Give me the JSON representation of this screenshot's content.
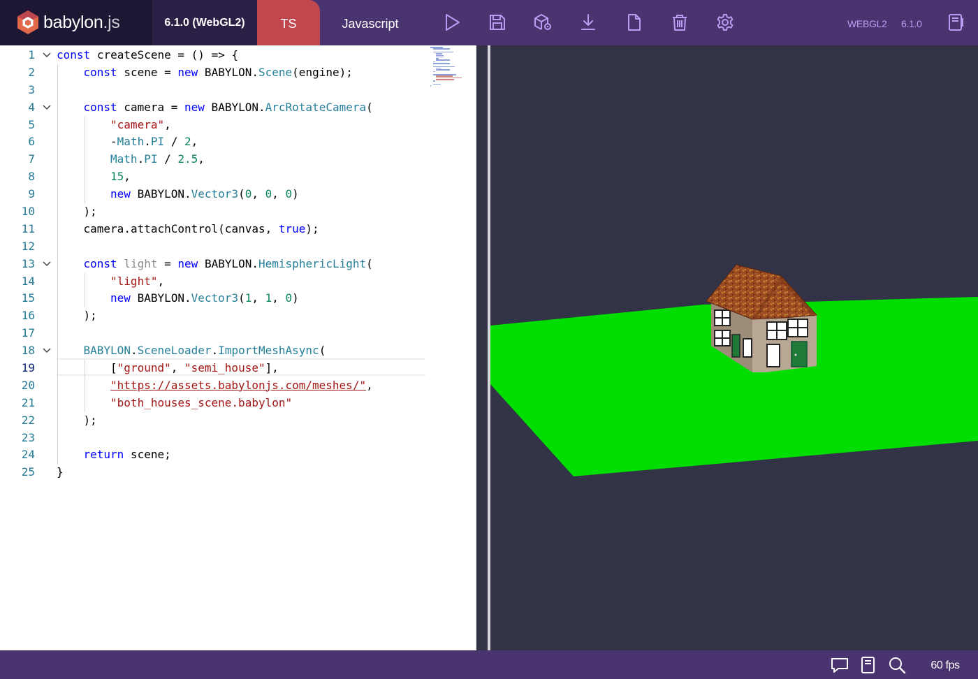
{
  "header": {
    "brand_name": "babylon",
    "brand_ext": ".js",
    "version_label": "6.1.0 (WebGL2)",
    "lang_ts": "TS",
    "lang_js": "Javascript",
    "engine_label": "WEBGL2",
    "version": "6.1.0",
    "toolbar_icons": [
      "play-icon",
      "save-icon",
      "cube-settings-icon",
      "download-icon",
      "new-file-icon",
      "trash-icon",
      "gear-icon",
      "examples-icon"
    ]
  },
  "editor": {
    "active_line": 19,
    "lines": [
      {
        "n": "1",
        "fold": true,
        "indent": 0,
        "tokens": [
          [
            "kw",
            "const"
          ],
          [
            "",
            "createScene = () => {"
          ]
        ]
      },
      {
        "n": "2",
        "fold": false,
        "indent": 1,
        "tokens": [
          [
            "kw",
            "const"
          ],
          [
            "",
            " scene = "
          ],
          [
            "kw",
            "new"
          ],
          [
            "",
            " BABYLON."
          ],
          [
            "cls",
            "Scene"
          ],
          [
            "",
            "(engine);"
          ]
        ]
      },
      {
        "n": "3",
        "fold": false,
        "indent": 0,
        "tokens": []
      },
      {
        "n": "4",
        "fold": true,
        "indent": 1,
        "tokens": [
          [
            "kw",
            "const"
          ],
          [
            "",
            " camera = "
          ],
          [
            "kw",
            "new"
          ],
          [
            "",
            " BABYLON."
          ],
          [
            "cls",
            "ArcRotateCamera"
          ],
          [
            "",
            "("
          ]
        ]
      },
      {
        "n": "5",
        "fold": false,
        "indent": 2,
        "tokens": [
          [
            "str",
            "\"camera\""
          ],
          [
            "",
            ","
          ]
        ]
      },
      {
        "n": "6",
        "fold": false,
        "indent": 2,
        "tokens": [
          [
            "",
            "-"
          ],
          [
            "cls",
            "Math"
          ],
          [
            "",
            "."
          ],
          [
            "cls",
            "PI"
          ],
          [
            "",
            " / "
          ],
          [
            "num",
            "2"
          ],
          [
            "",
            ","
          ]
        ]
      },
      {
        "n": "7",
        "fold": false,
        "indent": 2,
        "tokens": [
          [
            "cls",
            "Math"
          ],
          [
            "",
            "."
          ],
          [
            "cls",
            "PI"
          ],
          [
            "",
            " / "
          ],
          [
            "num",
            "2.5"
          ],
          [
            "",
            ","
          ]
        ]
      },
      {
        "n": "8",
        "fold": false,
        "indent": 2,
        "tokens": [
          [
            "num",
            "15"
          ],
          [
            "",
            ","
          ]
        ]
      },
      {
        "n": "9",
        "fold": false,
        "indent": 2,
        "tokens": [
          [
            "kw",
            "new"
          ],
          [
            "",
            " BABYLON."
          ],
          [
            "cls",
            "Vector3"
          ],
          [
            "",
            "("
          ],
          [
            "num",
            "0"
          ],
          [
            "",
            ", "
          ],
          [
            "num",
            "0"
          ],
          [
            "",
            ", "
          ],
          [
            "num",
            "0"
          ],
          [
            "",
            ")"
          ]
        ]
      },
      {
        "n": "10",
        "fold": false,
        "indent": 1,
        "tokens": [
          [
            "",
            ");"
          ]
        ]
      },
      {
        "n": "11",
        "fold": false,
        "indent": 1,
        "tokens": [
          [
            "",
            "camera.attachControl(canvas, "
          ],
          [
            "kw",
            "true"
          ],
          [
            "",
            ");"
          ]
        ]
      },
      {
        "n": "12",
        "fold": false,
        "indent": 0,
        "tokens": []
      },
      {
        "n": "13",
        "fold": true,
        "indent": 1,
        "tokens": [
          [
            "kw",
            "const"
          ],
          [
            "",
            " "
          ],
          [
            "unused",
            "light"
          ],
          [
            "",
            " = "
          ],
          [
            "kw",
            "new"
          ],
          [
            "",
            " BABYLON."
          ],
          [
            "cls",
            "HemisphericLight"
          ],
          [
            "",
            "("
          ]
        ]
      },
      {
        "n": "14",
        "fold": false,
        "indent": 2,
        "tokens": [
          [
            "str",
            "\"light\""
          ],
          [
            "",
            ","
          ]
        ]
      },
      {
        "n": "15",
        "fold": false,
        "indent": 2,
        "tokens": [
          [
            "kw",
            "new"
          ],
          [
            "",
            " BABYLON."
          ],
          [
            "cls",
            "Vector3"
          ],
          [
            "",
            "("
          ],
          [
            "num",
            "1"
          ],
          [
            "",
            ", "
          ],
          [
            "num",
            "1"
          ],
          [
            "",
            ", "
          ],
          [
            "num",
            "0"
          ],
          [
            "",
            ")"
          ]
        ]
      },
      {
        "n": "16",
        "fold": false,
        "indent": 1,
        "tokens": [
          [
            "",
            ");"
          ]
        ]
      },
      {
        "n": "17",
        "fold": false,
        "indent": 0,
        "tokens": []
      },
      {
        "n": "18",
        "fold": true,
        "indent": 1,
        "tokens": [
          [
            "cls",
            "BABYLON"
          ],
          [
            "",
            "."
          ],
          [
            "cls",
            "SceneLoader"
          ],
          [
            "",
            "."
          ],
          [
            "cls",
            "ImportMeshAsync"
          ],
          [
            "",
            "("
          ]
        ]
      },
      {
        "n": "19",
        "fold": false,
        "indent": 2,
        "tokens": [
          [
            "",
            "["
          ],
          [
            "str",
            "\"ground\""
          ],
          [
            "",
            ", "
          ],
          [
            "str",
            "\"semi_house\""
          ],
          [
            "",
            "],"
          ]
        ]
      },
      {
        "n": "20",
        "fold": false,
        "indent": 2,
        "tokens": [
          [
            "str",
            "\"https://assets.babylonjs.com/meshes/\""
          ],
          [
            "",
            ","
          ]
        ]
      },
      {
        "n": "21",
        "fold": false,
        "indent": 2,
        "tokens": [
          [
            "str",
            "\"both_houses_scene.babylon\""
          ]
        ]
      },
      {
        "n": "22",
        "fold": false,
        "indent": 1,
        "tokens": [
          [
            "",
            ");"
          ]
        ]
      },
      {
        "n": "23",
        "fold": false,
        "indent": 0,
        "tokens": []
      },
      {
        "n": "24",
        "fold": false,
        "indent": 1,
        "tokens": [
          [
            "kw",
            "return"
          ],
          [
            "",
            " scene;"
          ]
        ]
      },
      {
        "n": "25",
        "fold": false,
        "indent": 0,
        "tokens": [
          [
            "",
            "}"
          ]
        ]
      }
    ]
  },
  "scene": {
    "background": "#333348",
    "ground_color": "#00dd00",
    "roof_color": "#9a4a22",
    "wall_color": "#b8a792",
    "door_color": "#1f7a3a"
  },
  "footer": {
    "fps": "60 fps",
    "icons": [
      "feedback-icon",
      "docs-icon",
      "search-icon"
    ]
  }
}
